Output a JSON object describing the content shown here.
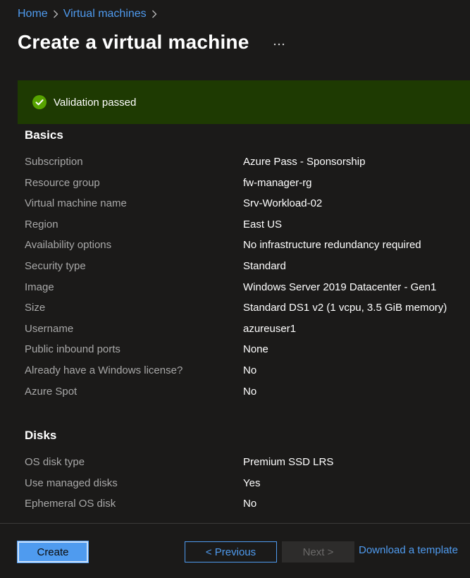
{
  "breadcrumb": {
    "home": "Home",
    "virtual_machines": "Virtual machines"
  },
  "page": {
    "title": "Create a virtual machine",
    "more_icon": "ellipsis-icon"
  },
  "validation": {
    "text": "Validation passed",
    "icon": "check-circle-icon",
    "status_color": "#57a300"
  },
  "basics": {
    "title": "Basics",
    "rows": [
      {
        "label": "Subscription",
        "value": "Azure Pass - Sponsorship"
      },
      {
        "label": "Resource group",
        "value": "fw-manager-rg"
      },
      {
        "label": "Virtual machine name",
        "value": "Srv-Workload-02"
      },
      {
        "label": "Region",
        "value": "East US"
      },
      {
        "label": "Availability options",
        "value": "No infrastructure redundancy required"
      },
      {
        "label": "Security type",
        "value": "Standard"
      },
      {
        "label": "Image",
        "value": "Windows Server 2019 Datacenter - Gen1"
      },
      {
        "label": "Size",
        "value": "Standard DS1 v2 (1 vcpu, 3.5 GiB memory)"
      },
      {
        "label": "Username",
        "value": "azureuser1"
      },
      {
        "label": "Public inbound ports",
        "value": "None"
      },
      {
        "label": "Already have a Windows license?",
        "value": "No"
      },
      {
        "label": "Azure Spot",
        "value": "No"
      }
    ]
  },
  "disks": {
    "title": "Disks",
    "rows": [
      {
        "label": "OS disk type",
        "value": "Premium SSD LRS"
      },
      {
        "label": "Use managed disks",
        "value": "Yes"
      },
      {
        "label": "Ephemeral OS disk",
        "value": "No"
      }
    ]
  },
  "footer": {
    "create_label": "Create",
    "previous_label": "< Previous",
    "next_label": "Next >",
    "download_label": "Download a template"
  },
  "colors": {
    "accent": "#4f9bef",
    "banner_bg": "#1e3a02",
    "background": "#1b1a19"
  }
}
